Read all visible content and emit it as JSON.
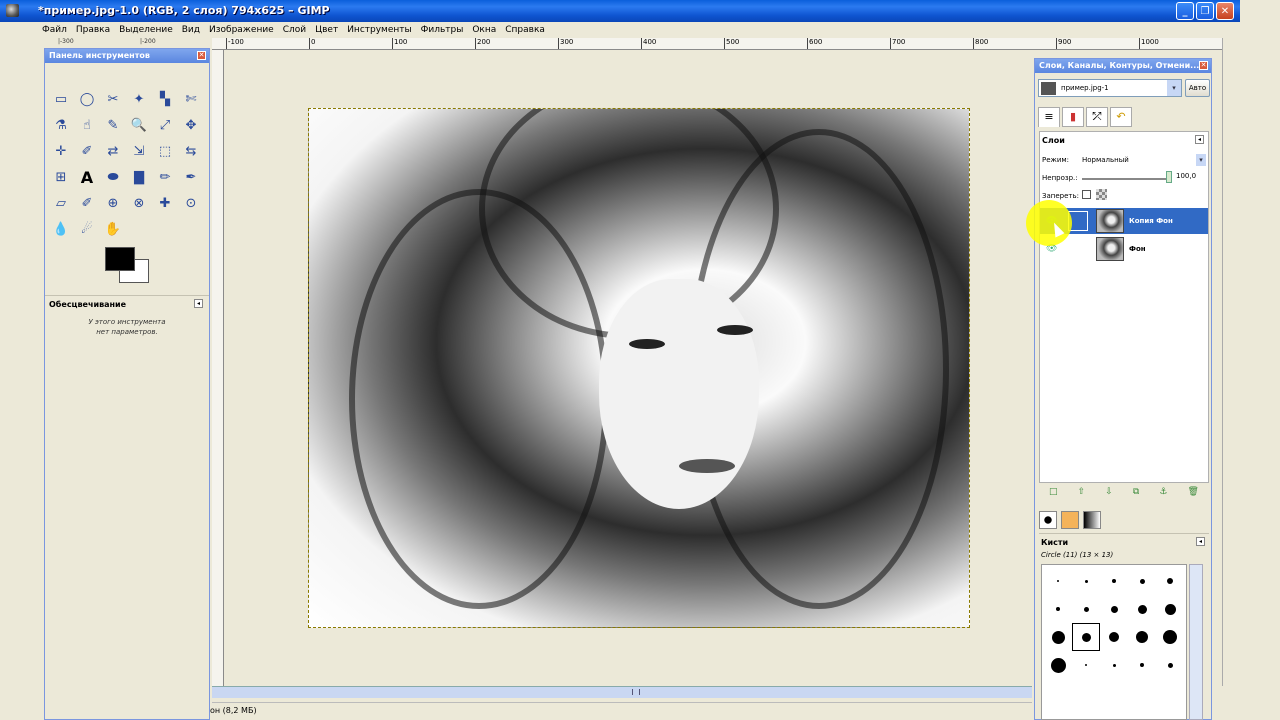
{
  "window": {
    "title": "*пример.jpg-1.0 (RGB, 2 слоя) 794x625 – GIMP",
    "min": "_",
    "max": "❐",
    "close": "✕"
  },
  "menu": [
    "Файл",
    "Правка",
    "Выделение",
    "Вид",
    "Изображение",
    "Слой",
    "Цвет",
    "Инструменты",
    "Фильтры",
    "Окна",
    "Справка"
  ],
  "ruler": {
    "small_left": "|-300",
    "small_left2": "|-200",
    "labels": [
      "-100",
      "0",
      "100",
      "200",
      "300",
      "400",
      "500",
      "600",
      "700",
      "800",
      "900",
      "1000"
    ]
  },
  "status": {
    "text": "он (8,2 МБ)"
  },
  "toolbox": {
    "title": "Панель инструментов",
    "close": "✕",
    "options_title": "Обесцвечивание",
    "options_msg_line1": "У этого инструмента",
    "options_msg_line2": "нет параметров.",
    "tools": [
      "▭",
      "◯",
      "✂",
      "✦",
      "▚",
      "✄",
      "⚗",
      "☝",
      "✎",
      "🔍",
      "⤢",
      "✥",
      "✛",
      "✐",
      "⇄",
      "⇲",
      "⬚",
      "⇆",
      "⊞",
      "A",
      "⬬",
      "▇",
      "✏",
      "✒",
      "▱",
      "✐",
      "⊕",
      "⊗",
      "✚",
      "⊙",
      "💧",
      "☄",
      "✋"
    ]
  },
  "dock": {
    "title": "Слои, Каналы, Контуры, Отмени...",
    "image_select": "пример.jpg-1",
    "auto_label": "Авто",
    "tabs": [
      "≡",
      "▮",
      "⤱",
      "↶"
    ],
    "layers_title": "Слои",
    "mode_label": "Режим:",
    "mode_value": "Нормальный",
    "opacity_label": "Непрозр.:",
    "opacity_value": "100,0",
    "lock_label": "Запереть:",
    "layers": [
      {
        "name": "Копия Фон",
        "selected": true
      },
      {
        "name": "Фон",
        "selected": false
      }
    ],
    "layer_buttons": [
      "□",
      "⇧",
      "⇩",
      "⧉",
      "⚓",
      "🗑"
    ],
    "brushes_title": "Кисти",
    "brushes_subtitle": "Circle (11) (13 × 13)"
  },
  "colors": {
    "fg": "#000000",
    "bg": "#ffffff",
    "selection": "#316ac5",
    "titlebar": "#0a5fdb"
  }
}
